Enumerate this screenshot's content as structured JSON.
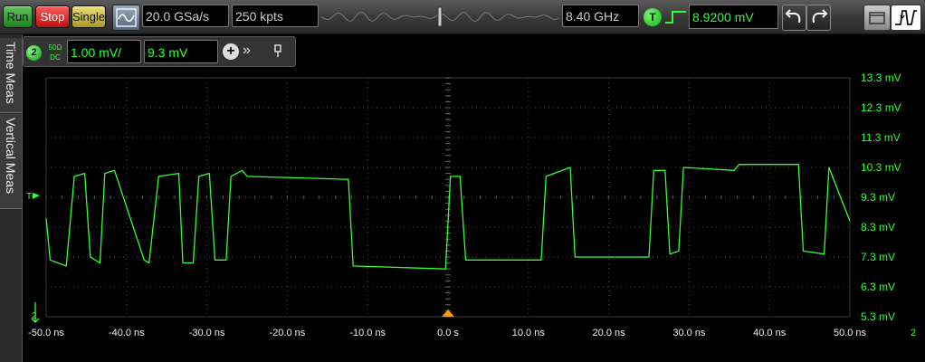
{
  "toolbar": {
    "run_label": "Run",
    "stop_label": "Stop",
    "single_label": "Single",
    "sample_rate": "20.0 GSa/s",
    "memory_depth": "250 kpts",
    "bandwidth": "8.40 GHz",
    "trigger_badge": "T",
    "trigger_level": "8.9200 mV"
  },
  "side_tabs": {
    "time_meas": "Time Meas",
    "vertical_meas": "Vertical Meas"
  },
  "channel": {
    "number": "2",
    "coupling_top": "50Ω",
    "coupling_bottom": "DC",
    "scale": "1.00 mV/",
    "offset": "9.3 mV"
  },
  "markers": {
    "trigger_level_marker": "T",
    "channel_ground_marker": "2",
    "x_right_label": "2"
  },
  "colors": {
    "trace": "#33ff33",
    "stop": "#e02020",
    "run": "#2a9a2a",
    "single": "#c9bb3a",
    "trigger_position": "#ff9900"
  },
  "chart_data": {
    "type": "line",
    "x_axis_labels": [
      "-50.0 ns",
      "-40.0 ns",
      "-30.0 ns",
      "-20.0 ns",
      "-10.0 ns",
      "0.0 s",
      "10.0 ns",
      "20.0 ns",
      "30.0 ns",
      "40.0 ns",
      "50.0 ns"
    ],
    "y_axis_labels": [
      "13.3 mV",
      "12.3 mV",
      "11.3 mV",
      "10.3 mV",
      "9.3 mV",
      "8.3 mV",
      "7.3 mV",
      "6.3 mV",
      "5.3 mV"
    ],
    "xlim": [
      -50,
      50
    ],
    "ylim": [
      5.3,
      13.3
    ],
    "grid": true,
    "series": [
      {
        "x": [
          -50,
          -49.5,
          -47.5,
          -46.5,
          -45.2,
          -44.5,
          -43.3,
          -42.7,
          -41.5,
          -37.8,
          -37.2,
          -36,
          -33.5,
          -33,
          -31.7,
          -31,
          -29.7,
          -29,
          -27.6,
          -27,
          -25.6,
          -25,
          -12.4,
          -11.8,
          -0.3,
          0.3,
          1.5,
          2.2,
          11.6,
          12.2,
          15.2,
          15.8,
          25,
          25.6,
          27,
          27.6,
          28.7,
          29.3,
          35.6,
          36.2,
          43.6,
          44.2,
          46.8,
          47.4,
          50
        ],
        "y": [
          8.6,
          7.2,
          7.0,
          10.0,
          10.1,
          7.3,
          7.1,
          10.1,
          10.2,
          7.2,
          7.1,
          10.0,
          10.1,
          7.1,
          7.1,
          10.0,
          10.1,
          7.2,
          7.2,
          10.0,
          10.2,
          10.0,
          9.9,
          7.0,
          6.9,
          10.0,
          10.0,
          7.2,
          7.2,
          10.0,
          10.3,
          7.3,
          7.3,
          10.2,
          10.2,
          7.4,
          7.5,
          10.3,
          10.2,
          10.4,
          10.4,
          7.5,
          7.4,
          10.3,
          8.5
        ]
      }
    ]
  }
}
